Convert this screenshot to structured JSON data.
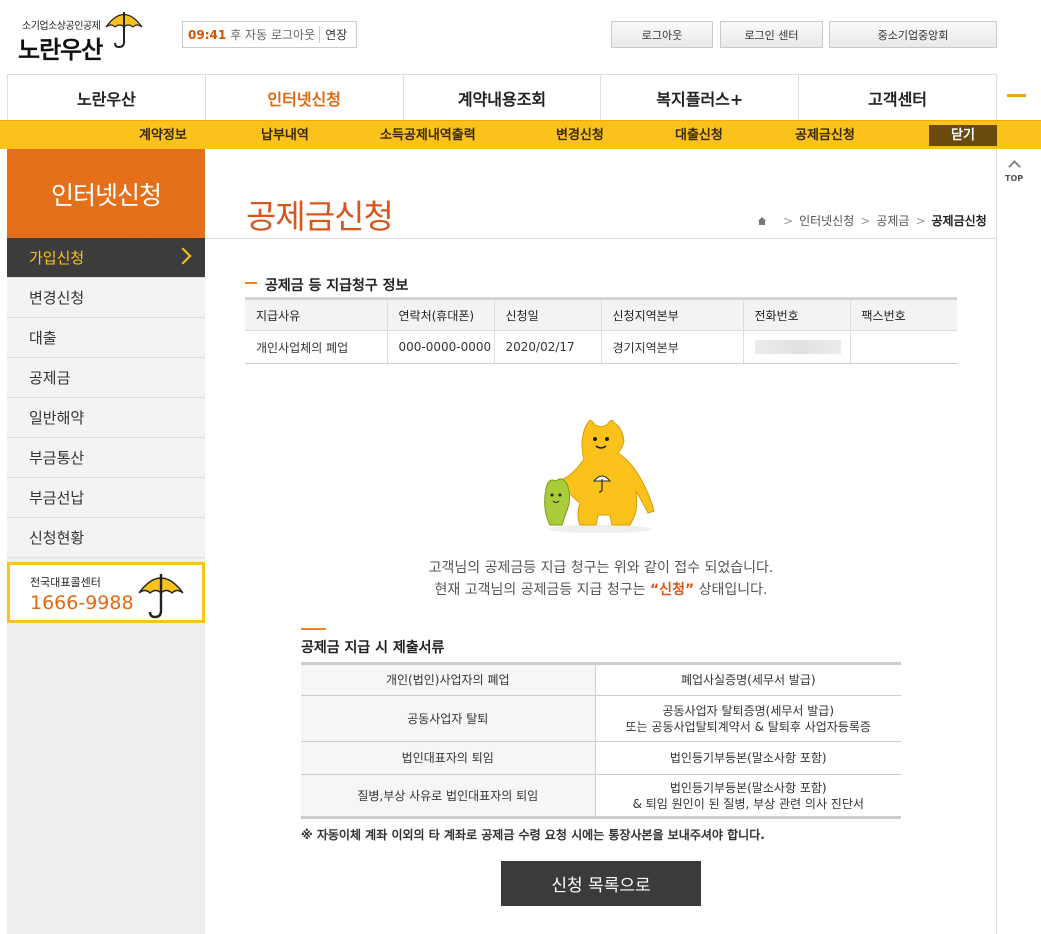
{
  "header": {
    "logo_small": "소기업소상공인공제",
    "logo_big": "노란우산",
    "session_time": "09:41",
    "session_msg": "후 자동 로그아웃",
    "session_extend": "연장",
    "buttons": [
      "로그아웃",
      "로그인 센터",
      "중소기업중앙회"
    ]
  },
  "gnb": [
    "노란우산",
    "인터넷신청",
    "계약내용조회",
    "복지플러스+",
    "고객센터"
  ],
  "gnb_active": "인터넷신청",
  "subnav": [
    "계약정보",
    "납부내역",
    "소득공제내역출력",
    "변경신청",
    "대출신청",
    "공제금신청"
  ],
  "subnav_close": "닫기",
  "sidebar": {
    "title": "인터넷신청",
    "items": [
      "가입신청",
      "변경신청",
      "대출",
      "공제금",
      "일반해약",
      "부금통산",
      "부금선납",
      "신청현황"
    ],
    "callcenter_label": "전국대표콜센터",
    "callcenter_phone": "1666-9988"
  },
  "top_button": "TOP",
  "page": {
    "title": "공제금신청",
    "breadcrumb": [
      "인터넷신청",
      "공제금",
      "공제금신청"
    ]
  },
  "info_section": {
    "title": "공제금 등 지급청구 정보",
    "columns": [
      "지급사유",
      "연락처(휴대폰)",
      "신청일",
      "신청지역본부",
      "전화번호",
      "팩스번호"
    ],
    "row": [
      "개인사업체의 폐업",
      "000-0000-0000",
      "2020/02/17",
      "경기지역본부",
      "",
      ""
    ]
  },
  "status": {
    "line1": "고객님의 공제금등 지급 청구는 위와 같이 접수 되었습니다.",
    "line2_prefix": "현재 고객님의 공제금등 지급 청구는 ",
    "line2_status": "“신청”",
    "line2_suffix": " 상태입니다."
  },
  "docs_section": {
    "title": "공제금 지급 시 제출서류",
    "rows": [
      {
        "reason": "개인(법인)사업자의 폐업",
        "docs": [
          "폐업사실증명(세무서 발급)"
        ]
      },
      {
        "reason": "공동사업자 탈퇴",
        "docs": [
          "공동사업자 탈퇴증명(세무서 발급)",
          "또는 공동사업탈퇴계약서 & 탈퇴후 사업자등록증"
        ]
      },
      {
        "reason": "법인대표자의 퇴임",
        "docs": [
          "법인등기부등본(말소사항 포함)"
        ]
      },
      {
        "reason": "질병,부상 사유로 법인대표자의 퇴임",
        "docs": [
          "법인등기부등본(말소사항 포함)",
          "& 퇴임 원인이 된 질병, 부상 관련 의사 진단서"
        ]
      }
    ],
    "note": "※ 자동이체 계좌 이외의 타 계좌로 공제금 수령 요청 시에는 통장사본을 보내주셔야 합니다."
  },
  "list_button": "신청 목록으로",
  "colors": {
    "accent_orange": "#d8561c",
    "subnav_yellow": "#fbc21c",
    "sidebar_active": "#3c3c3c"
  }
}
